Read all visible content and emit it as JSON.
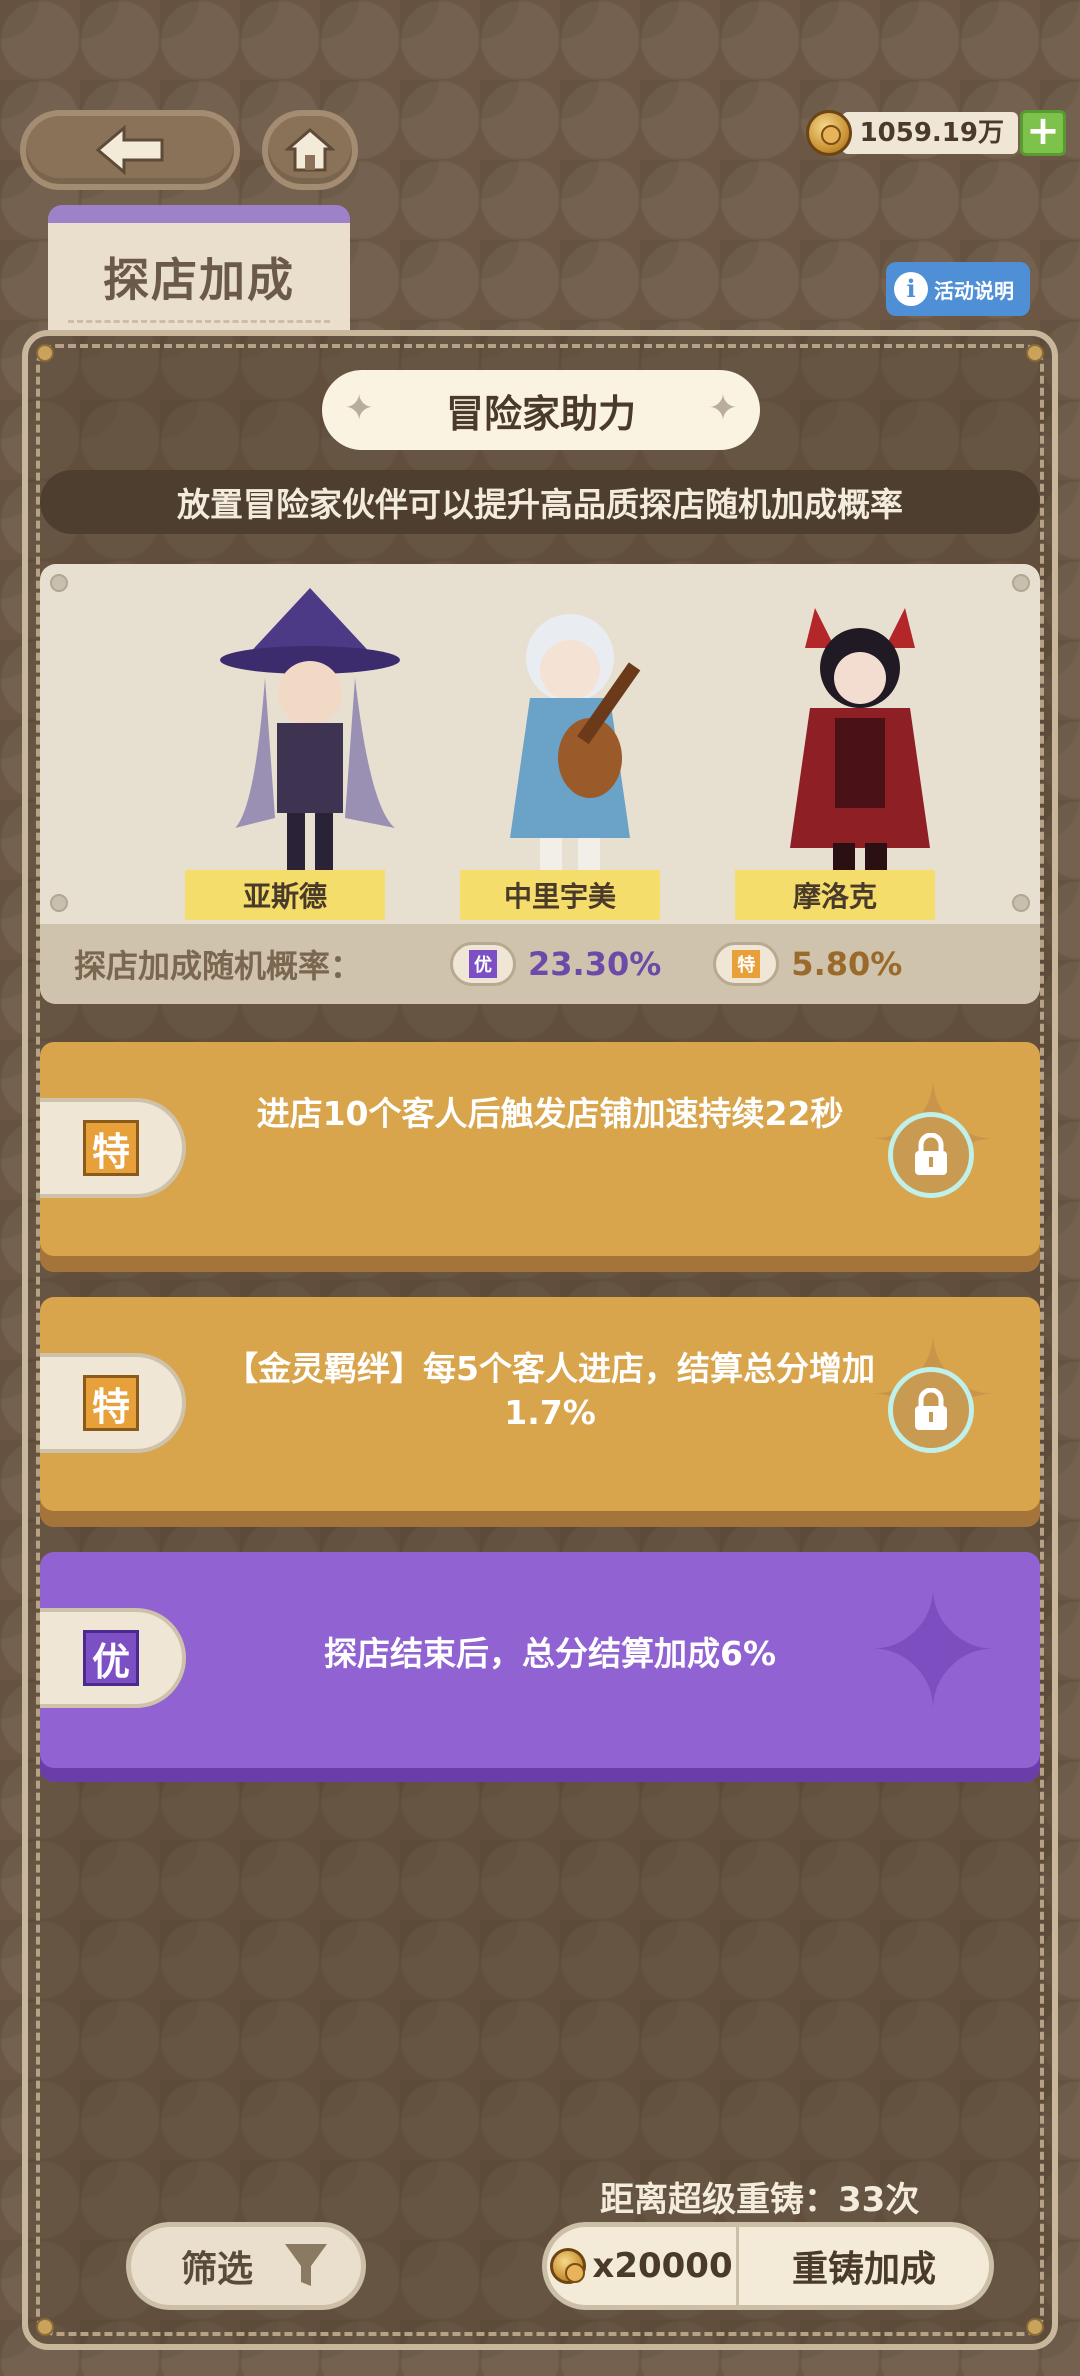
{
  "header": {
    "currency_value": "1059.19万",
    "plus_label": "+",
    "tab_label": "探店加成",
    "info_label": "活动说明",
    "info_icon_glyph": "i"
  },
  "section": {
    "title": "冒险家助力",
    "subtitle": "放置冒险家伙伴可以提升高品质探店随机加成概率"
  },
  "characters": [
    {
      "name": "亚斯德",
      "icon": "witch-character-icon"
    },
    {
      "name": "中里宇美",
      "icon": "bard-character-icon"
    },
    {
      "name": "摩洛克",
      "icon": "demon-character-icon"
    }
  ],
  "rates": {
    "label": "探店加成随机概率：",
    "items": [
      {
        "tag": "优",
        "value": "23.30%",
        "color": "#6b4aa8"
      },
      {
        "tag": "特",
        "value": "5.80%",
        "color": "#9a6a2a"
      }
    ]
  },
  "effects": [
    {
      "tag": "特",
      "text": "进店10个客人后触发店铺加速持续22秒",
      "locked": true,
      "theme": "gold"
    },
    {
      "tag": "特",
      "text": "【金灵羁绊】每5个客人进店，结算总分增加1.7%",
      "locked": true,
      "theme": "gold"
    },
    {
      "tag": "优",
      "text": "探店结束后，总分结算加成6%",
      "locked": false,
      "theme": "purple"
    }
  ],
  "footer": {
    "reforge_count": "距离超级重铸：33次",
    "filter_label": "筛选",
    "reforge_cost": "x20000",
    "reforge_label": "重铸加成"
  },
  "colors": {
    "gold": "#d9a54c",
    "purple": "#9163d2",
    "tag_gold": "#e8a03a",
    "tag_purple": "#7c4fc4"
  }
}
